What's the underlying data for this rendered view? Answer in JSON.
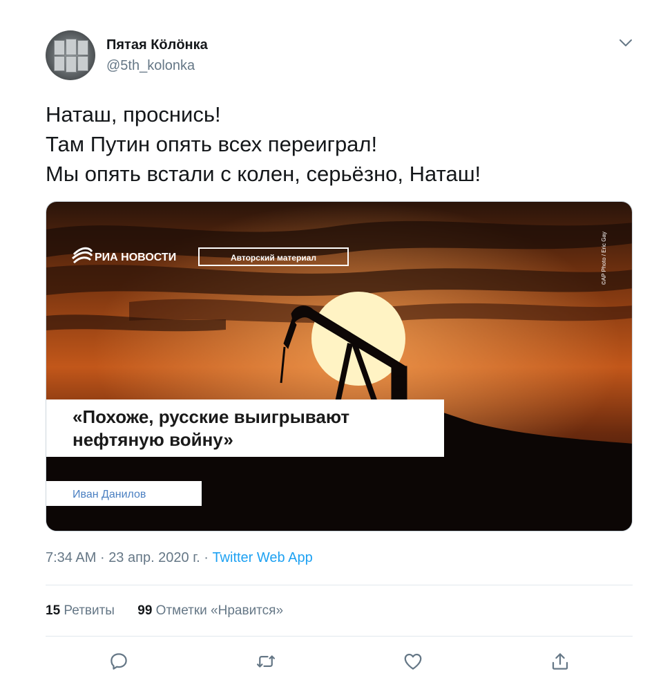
{
  "user": {
    "name": "Пятая Кӧлӧнка",
    "handle": "@5th_kolonka"
  },
  "tweet": {
    "lines": [
      "Наташ, проснись!",
      "Там Путин опять всех переиграл!",
      "Мы опять встали с колен, серьёзно, Наташ!"
    ]
  },
  "media": {
    "brand": "РИА НОВОСТИ",
    "tag": "Авторский материал",
    "credit": "©AP Photo / Eric Gay",
    "headline_line1": "«Похоже, русские выигрывают",
    "headline_line2": "нефтяную войну»",
    "author": "Иван Данилов"
  },
  "meta": {
    "time": "7:34 AM",
    "separator1": "·",
    "date": "23 апр. 2020 г.",
    "separator2": "·",
    "source": "Twitter Web App"
  },
  "stats": {
    "retweets_count": "15",
    "retweets_label": "Ретвиты",
    "likes_count": "99",
    "likes_label": "Отметки «Нравится»"
  },
  "icons": {
    "menu": "chevron-down-icon",
    "reply": "reply-icon",
    "retweet": "retweet-icon",
    "like": "heart-icon",
    "share": "share-icon"
  },
  "colors": {
    "link": "#1da1f2",
    "secondary_text": "#657786",
    "primary_text": "#14171a"
  }
}
